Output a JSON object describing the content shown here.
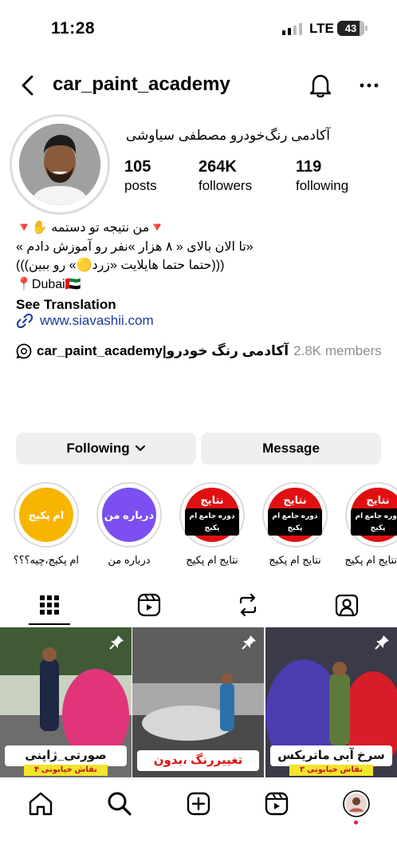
{
  "status_bar": {
    "time": "11:28",
    "network": "LTE",
    "battery": "43"
  },
  "header": {
    "username": "car_paint_academy"
  },
  "profile": {
    "display_name": "آکادمی رنگ‌خودرو مصطفی سیاوشی",
    "stats": [
      {
        "value": "105",
        "label": "posts"
      },
      {
        "value": "264K",
        "label": "followers"
      },
      {
        "value": "119",
        "label": "following"
      }
    ],
    "bio_lines": [
      "🔻من نتیجه تو دستمه ✋🔻",
      "«تا الان بالای « ۸ هزار »نفر رو آموزش دادم »",
      "(((حتما حتما هایلایت «زرد🟡» رو ببین)))",
      "📍Dubai🇦🇪"
    ],
    "see_translation": "See Translation",
    "link": "www.siavashii.com",
    "channel": {
      "title": "car_paint_academy|آکادمی رنگ خودرو",
      "members": "2.8K members"
    }
  },
  "actions": {
    "following_label": "Following",
    "message_label": "Message"
  },
  "highlights": [
    {
      "cover": "ام پکیج",
      "label": "ام پکیج،چیه؟؟؟",
      "color": "#f7b500"
    },
    {
      "cover": "درباره من",
      "label": "درباره من",
      "color": "#7b4ff0"
    },
    {
      "cover_top": "نتایج",
      "cover_box": "دوره جامع ام پکیج",
      "label": "نتایج ام پکیج",
      "color": "#e01010"
    },
    {
      "cover_top": "نتایج",
      "cover_box": "دوره جامع ام پکیج",
      "label": "نتایج ام پکیج",
      "color": "#e01010"
    },
    {
      "cover_top": "نتایج",
      "cover_box": "دوره جامع ام پکیج",
      "label": "نتایج ام پکیج",
      "color": "#e01010"
    }
  ],
  "posts": [
    {
      "caption": "صورتی_ژاپنی",
      "sub": "نقاش خیابونی ۴",
      "caption_color": "#111",
      "accent": "#e0357a"
    },
    {
      "caption": "تغییررنگ ،بدون مجوز",
      "sub": "",
      "caption_color": "#e01010",
      "accent": "#bdbdbd"
    },
    {
      "caption": "سرخ آبی ماتریکس",
      "sub": "نقاش خیابونی ۳",
      "caption_color": "#111",
      "accent": "#4a3db0"
    }
  ],
  "tabs": [
    "grid-icon",
    "reels-icon",
    "reposts-icon",
    "tagged-icon"
  ],
  "nav": [
    "home-icon",
    "search-icon",
    "create-icon",
    "reels-icon",
    "profile-avatar"
  ]
}
